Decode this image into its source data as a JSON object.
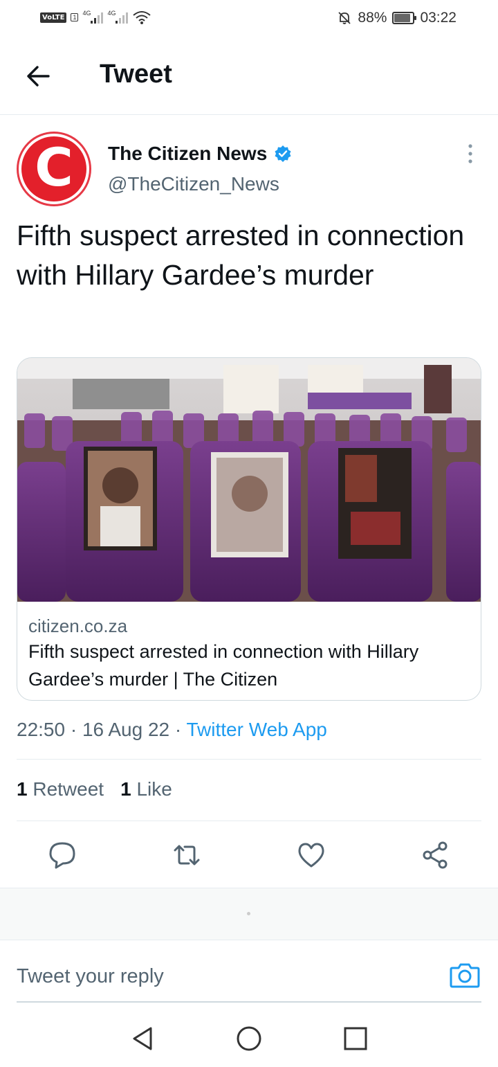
{
  "status_bar": {
    "volte": "VoLTE",
    "sim": "1",
    "network1": "4G",
    "network2": "4G",
    "battery_percent": "88%",
    "battery_level": 0.88,
    "time": "03:22"
  },
  "header": {
    "title": "Tweet"
  },
  "tweet": {
    "author_name": "The Citizen News",
    "author_handle": "@TheCitizen_News",
    "avatar_letter": "C",
    "text": "Fifth suspect arrested in connection with Hillary Gardee’s murder",
    "card": {
      "domain": "citizen.co.za",
      "title": "Fifth suspect arrested in connection with Hillary Gardee’s murder | The Citizen"
    },
    "time": "22:50",
    "date": "16 Aug 22",
    "source": "Twitter Web App",
    "retweet_count": "1",
    "retweet_label": "Retweet",
    "like_count": "1",
    "like_label": "Like"
  },
  "reply": {
    "placeholder": "Tweet your reply"
  },
  "colors": {
    "accent": "#1d9bf0",
    "brand_red": "#e3202b",
    "text_secondary": "#536471"
  }
}
